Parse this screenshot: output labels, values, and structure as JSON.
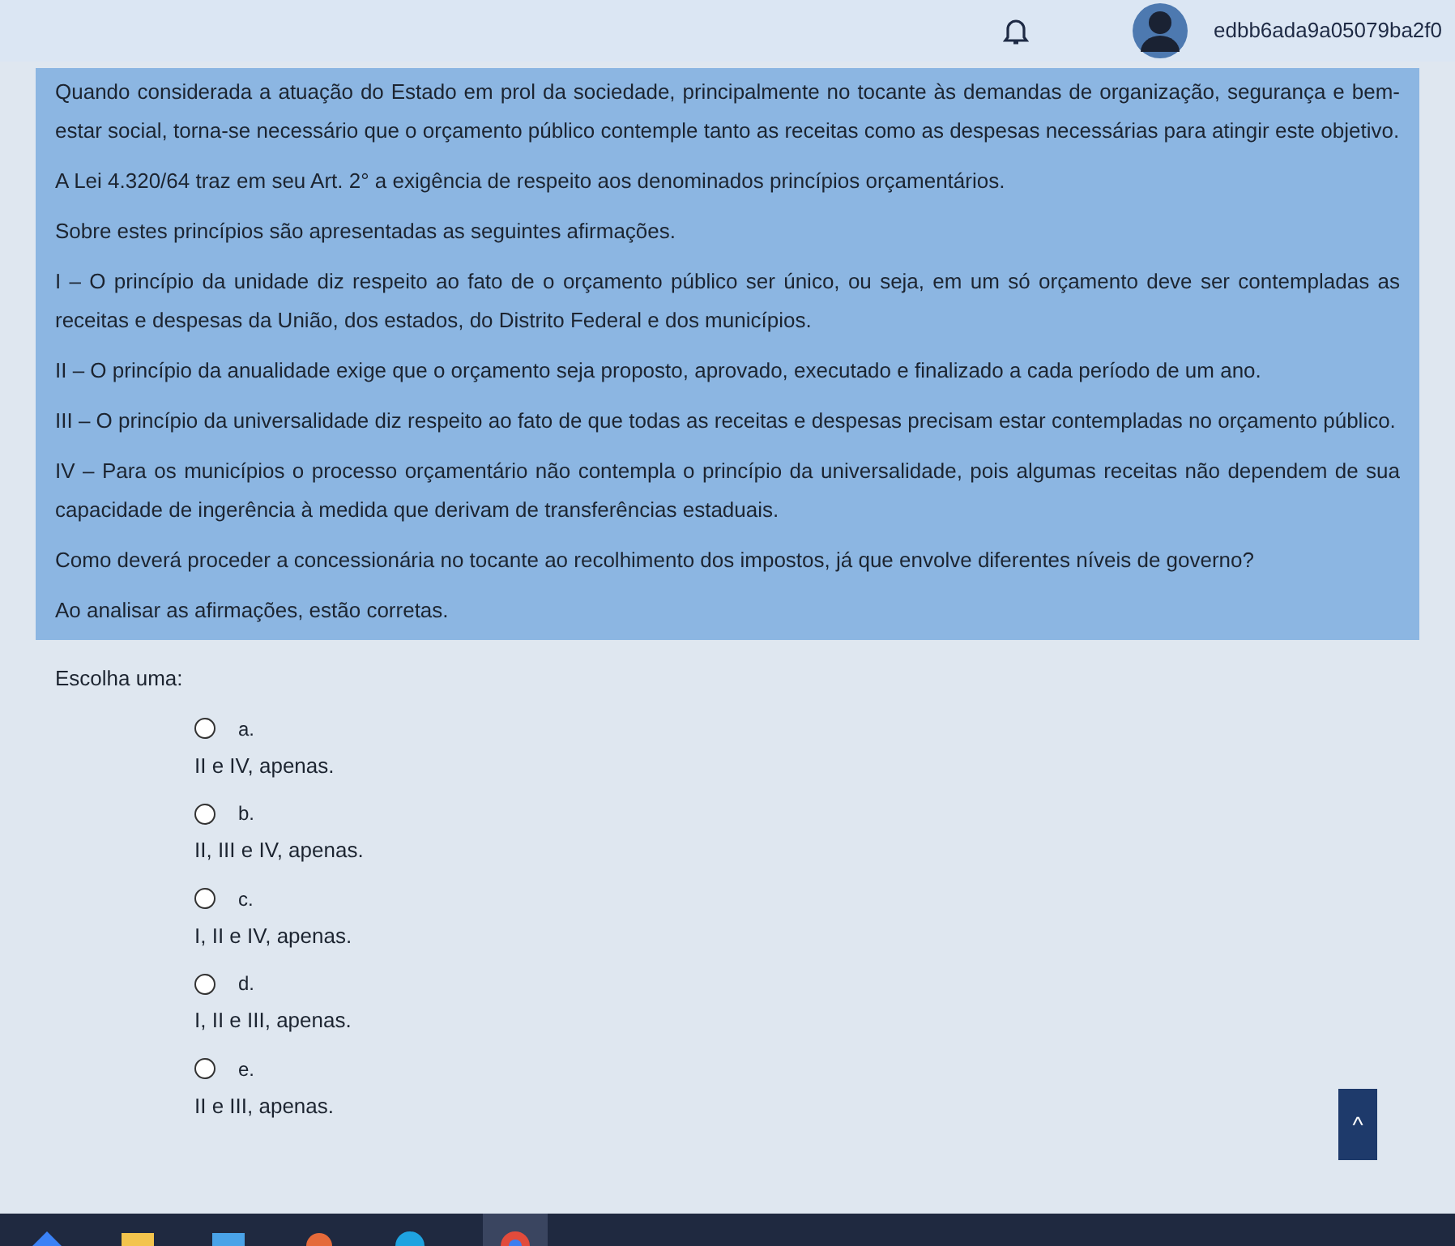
{
  "header": {
    "user_id": "edbb6ada9a05079ba2f0"
  },
  "question": {
    "paragraphs": [
      "Quando considerada a atuação do Estado em prol da sociedade, principalmente no tocante às demandas de organização, segurança e bem-estar social, torna-se necessário que o orçamento público contemple tanto as receitas como as despesas necessárias para atingir este objetivo.",
      "A Lei 4.320/64 traz em seu Art. 2° a exigência de respeito aos denominados princípios orçamentários.",
      "Sobre estes princípios são apresentadas as seguintes afirmações.",
      "I – O princípio da unidade diz respeito ao fato de o orçamento público ser único, ou seja, em um só orçamento deve ser contempladas as receitas e despesas da União, dos estados, do Distrito Federal e dos municípios.",
      "II – O princípio da anualidade exige que o orçamento seja proposto, aprovado, executado e finalizado a cada período de um ano.",
      "III – O princípio da universalidade diz respeito ao fato de que todas as receitas e despesas precisam estar contempladas no orçamento público.",
      "IV – Para os municípios o processo orçamentário não contempla o princípio da universalidade, pois algumas receitas não dependem de sua capacidade de ingerência à medida que derivam de transferências estaduais.",
      "Como deverá proceder a concessionária no tocante ao recolhimento dos impostos, já que envolve diferentes níveis de governo?",
      "Ao analisar as afirmações, estão corretas."
    ]
  },
  "prompt": "Escolha uma:",
  "options": [
    {
      "letter": "a.",
      "text": "II e IV, apenas.",
      "selected": false
    },
    {
      "letter": "b.",
      "text": "II, III e IV, apenas.",
      "selected": false
    },
    {
      "letter": "c.",
      "text": "I, II e IV, apenas.",
      "selected": false
    },
    {
      "letter": "d.",
      "text": "I, II e III, apenas.",
      "selected": false
    },
    {
      "letter": "e.",
      "text": "II e III, apenas.",
      "selected": false
    }
  ],
  "scroll_top_button": {
    "label": "^"
  }
}
